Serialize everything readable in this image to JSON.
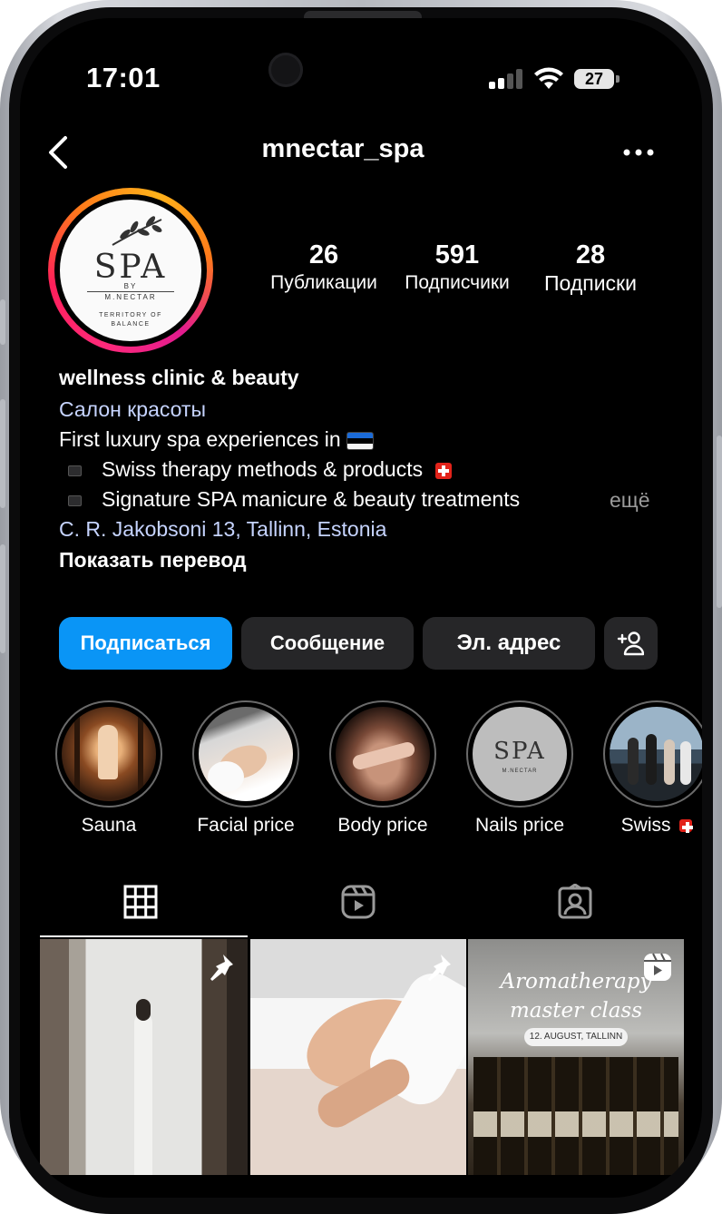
{
  "status_bar": {
    "time": "17:01",
    "battery": "27"
  },
  "header": {
    "username": "mnectar_spa",
    "back_icon": "chevron-left-icon",
    "more_icon": "more-horizontal-icon"
  },
  "avatar": {
    "logo_text": "SPA",
    "logo_by": "BY",
    "logo_brand": "M.NECTAR",
    "logo_subtitle": "TERRITORY OF BALANCE"
  },
  "stats": [
    {
      "value": "26",
      "label": "Публикации"
    },
    {
      "value": "591",
      "label": "Подписчики"
    },
    {
      "value": "28",
      "label": "Подписки"
    }
  ],
  "bio": {
    "name": "wellness clinic & beauty",
    "category": "Салон красоты",
    "line1": "First luxury spa experiences in",
    "line2": "Swiss therapy methods & products",
    "line3": "Signature SPA manicure & beauty treatments",
    "more": "ещё",
    "address": "C. R. Jakobsoni  13, Tallinn, Estonia",
    "translate": "Показать перевод"
  },
  "actions": {
    "follow": "Подписаться",
    "message": "Сообщение",
    "email": "Эл. адрес",
    "add_user_icon": "add-user-icon"
  },
  "highlights": [
    {
      "label": "Sauna"
    },
    {
      "label": "Facial price"
    },
    {
      "label": "Body price"
    },
    {
      "label": "Nails price"
    },
    {
      "label": "Swiss"
    }
  ],
  "tabs": [
    {
      "icon": "grid-icon",
      "active": true
    },
    {
      "icon": "reels-icon",
      "active": false
    },
    {
      "icon": "tagged-icon",
      "active": false
    }
  ],
  "posts": {
    "tile3_title_line1": "Aromatherapy",
    "tile3_title_line2": "master class",
    "tile3_date": "12. AUGUST, TALLINN"
  },
  "colors": {
    "follow_button": "#0a95f6",
    "link": "#c6d4ff",
    "background": "#000000"
  }
}
